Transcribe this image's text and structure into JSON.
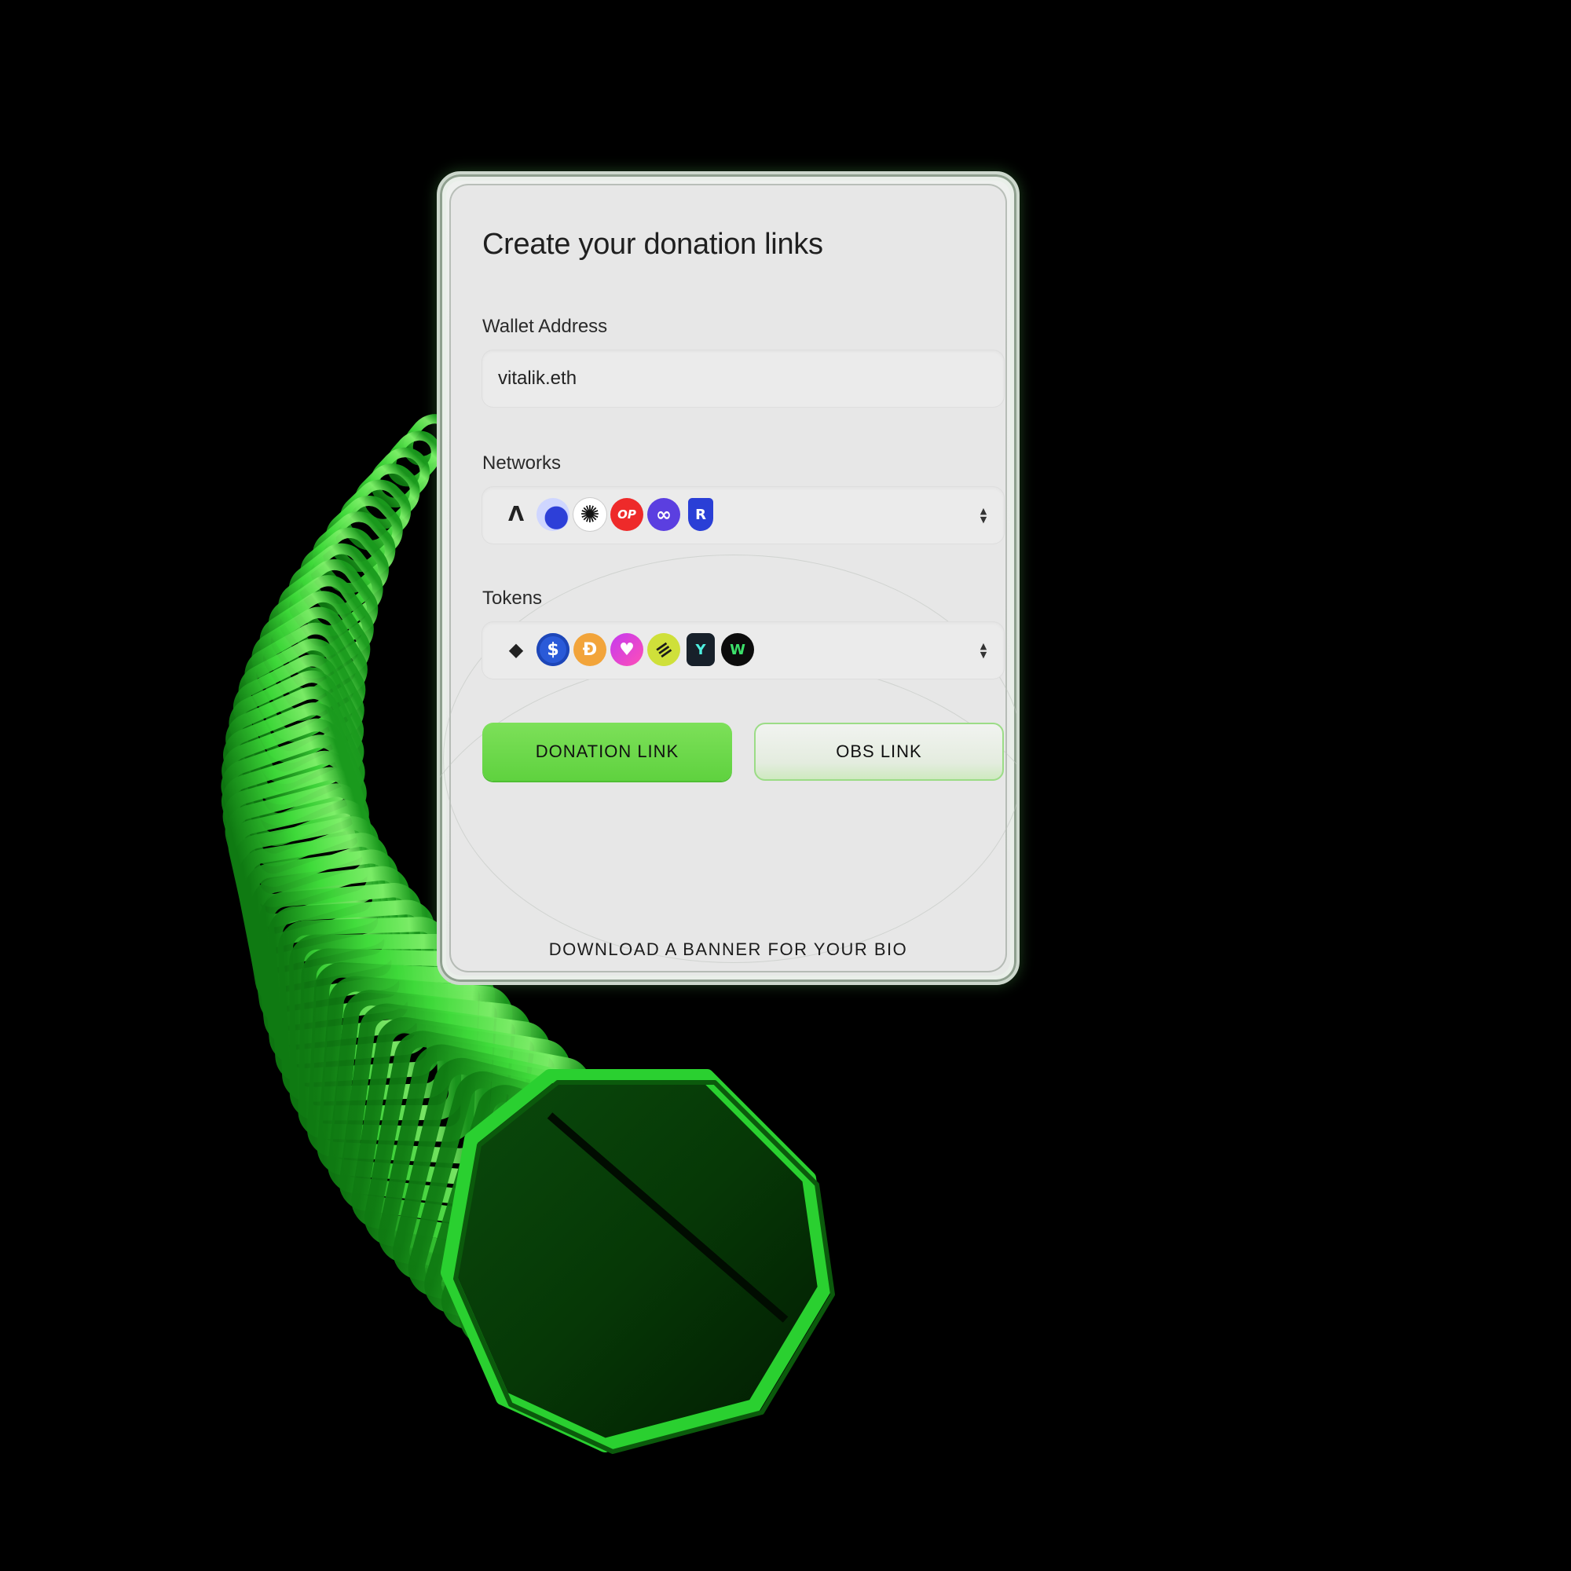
{
  "card": {
    "title": "Create your donation links",
    "wallet": {
      "label": "Wallet Address",
      "value": "vitalik.eth"
    },
    "networks": {
      "label": "Networks",
      "icons": [
        {
          "name": "arbitrum-icon",
          "glyph": "Ʌ"
        },
        {
          "name": "base-icon",
          "glyph": ""
        },
        {
          "name": "sunburst-network-icon",
          "glyph": "✺"
        },
        {
          "name": "optimism-icon",
          "glyph": "OP"
        },
        {
          "name": "polygon-icon",
          "glyph": "∞"
        },
        {
          "name": "shield-network-icon",
          "glyph": "R"
        }
      ]
    },
    "tokens": {
      "label": "Tokens",
      "icons": [
        {
          "name": "ethereum-icon",
          "glyph": "◆"
        },
        {
          "name": "usdc-icon",
          "glyph": "$"
        },
        {
          "name": "dai-icon",
          "glyph": "Đ"
        },
        {
          "name": "heart-token-icon",
          "glyph": "♥"
        },
        {
          "name": "stripes-token-icon",
          "glyph": "≡"
        },
        {
          "name": "shield-token-icon",
          "glyph": "Y"
        },
        {
          "name": "wave-token-icon",
          "glyph": "W"
        }
      ]
    },
    "buttons": {
      "primary": "DONATION LINK",
      "secondary": "OBS LINK"
    },
    "footer_link": "DOWNLOAD A BANNER FOR YOUR BIO"
  },
  "colors": {
    "accent": "#66d843",
    "background": "#000000",
    "card": "#e7e7e7",
    "coil": "#22c22a"
  }
}
